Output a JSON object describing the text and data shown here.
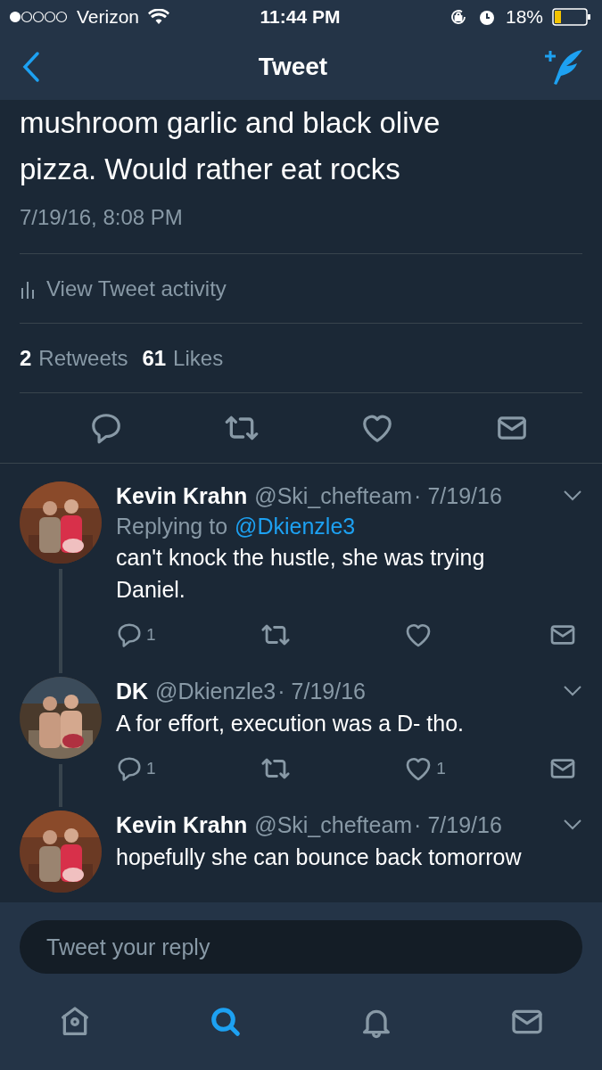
{
  "status_bar": {
    "carrier": "Verizon",
    "time": "11:44 PM",
    "battery": "18%"
  },
  "header": {
    "title": "Tweet"
  },
  "tweet": {
    "text_lines": [
      "mushroom garlic and black olive",
      "pizza. Would rather eat rocks"
    ],
    "timestamp": "7/19/16, 8:08 PM",
    "activity": "View Tweet activity",
    "retweets": {
      "count": "2",
      "label": "Retweets"
    },
    "likes": {
      "count": "61",
      "label": "Likes"
    }
  },
  "replies": [
    {
      "name": "Kevin Krahn",
      "handle": "@Ski_chefteam",
      "date": "· 7/19/16",
      "replying_label": "Replying to",
      "replying_to": "@Dkienzle3",
      "text": "can't knock the hustle, she was trying Daniel.",
      "reply_count": "1"
    },
    {
      "name": "DK",
      "handle": "@Dkienzle3",
      "date": "· 7/19/16",
      "text": "A for effort, execution was a D- tho.",
      "reply_count": "1",
      "like_count": "1"
    },
    {
      "name": "Kevin Krahn",
      "handle": "@Ski_chefteam",
      "date": "· 7/19/16",
      "text": "hopefully she can bounce back tomorrow"
    }
  ],
  "composer": {
    "placeholder": "Tweet your reply"
  },
  "tab_bar": [
    {
      "kind": "home",
      "selected": false
    },
    {
      "kind": "search",
      "selected": true
    },
    {
      "kind": "notifications",
      "selected": false
    },
    {
      "kind": "messages",
      "selected": false
    }
  ]
}
